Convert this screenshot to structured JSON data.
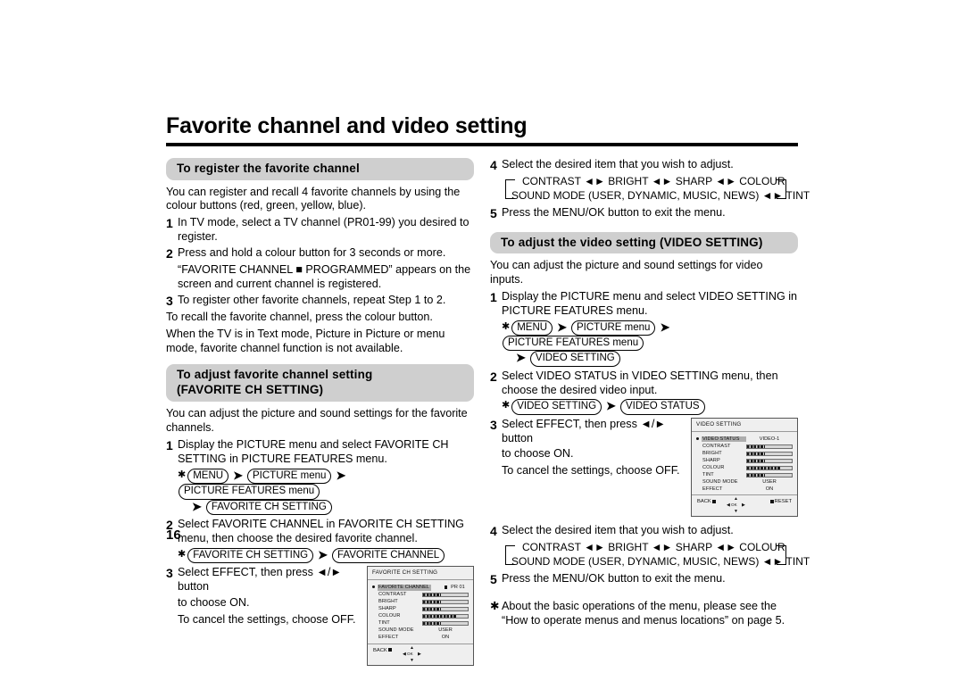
{
  "document": {
    "title": "Favorite channel and video setting",
    "page_number": "16"
  },
  "left_column": {
    "section1": {
      "heading": "To register the favorite channel",
      "intro": "You can register and recall 4 favorite channels by using the colour buttons (red, green, yellow, blue).",
      "steps": [
        {
          "num": "1",
          "text": "In TV mode, select a TV channel (PR01-99) you desired to register."
        },
        {
          "num": "2",
          "text": "Press and hold a colour button for 3 seconds or more."
        },
        {
          "num": "3",
          "text": "To register other favorite channels, repeat Step 1 to 2."
        }
      ],
      "step2_sub": "“FAVORITE CHANNEL ■ PROGRAMMED” appears on the screen and current channel is registered.",
      "outro1": "To recall the favorite channel, press the colour button.",
      "outro2": "When the TV is in Text mode, Picture in Picture or menu mode, favorite channel function is not available."
    },
    "section2": {
      "heading_line1": "To adjust favorite channel setting",
      "heading_line2": "(FAVORITE CH SETTING)",
      "intro": "You can adjust the picture and sound settings for the favorite channels.",
      "step1_num": "1",
      "step1_text": "Display the PICTURE menu and select FAVORITE CH SETTING in PICTURE FEATURES menu.",
      "crumbs1": [
        "MENU",
        "PICTURE menu",
        "PICTURE FEATURES menu",
        "FAVORITE CH SETTING"
      ],
      "step2_num": "2",
      "step2_text": "Select FAVORITE CHANNEL in FAVORITE CH SETTING menu, then choose the desired favorite channel.",
      "crumbs2": [
        "FAVORITE CH SETTING",
        "FAVORITE CHANNEL"
      ],
      "step3_num": "3",
      "step3_line1": "Select EFFECT, then press ◄/► button",
      "step3_line2": "to choose ON.",
      "step3_line3": "To cancel the settings, choose OFF."
    },
    "osd_favorite": {
      "title": "FAVORITE CH SETTING",
      "rows": [
        {
          "label": "FAVORITE CHANNEL",
          "type": "channel",
          "value": "PR 01",
          "selected": true
        },
        {
          "label": "CONTRAST",
          "type": "bar",
          "fill": 40
        },
        {
          "label": "BRIGHT",
          "type": "bar",
          "fill": 40
        },
        {
          "label": "SHARP",
          "type": "bar",
          "fill": 40
        },
        {
          "label": "COLOUR",
          "type": "bar",
          "fill": 75
        },
        {
          "label": "TINT",
          "type": "bar",
          "fill": 40
        },
        {
          "label": "SOUND MODE",
          "type": "text",
          "value": "USER"
        },
        {
          "label": "EFFECT",
          "type": "text",
          "value": "ON"
        }
      ],
      "back_label": "BACK",
      "ok_label": "OK",
      "reset_label": ""
    }
  },
  "right_column": {
    "section1_cont": {
      "step4_num": "4",
      "step4_text": "Select the desired item that you wish to adjust.",
      "cycle_row1": "CONTRAST ◄► BRIGHT ◄► SHARP ◄► COLOUR",
      "cycle_row2": "SOUND MODE (USER, DYNAMIC, MUSIC, NEWS) ◄► TINT",
      "step5_num": "5",
      "step5_text": "Press the MENU/OK button to exit the menu."
    },
    "section3": {
      "heading": "To adjust the video setting (VIDEO SETTING)",
      "intro": "You can adjust the picture and sound settings for video inputs.",
      "step1_num": "1",
      "step1_text": "Display the PICTURE menu and select VIDEO SETTING in PICTURE FEATURES menu.",
      "crumbs1": [
        "MENU",
        "PICTURE menu",
        "PICTURE FEATURES menu",
        "VIDEO SETTING"
      ],
      "step2_num": "2",
      "step2_text": "Select VIDEO STATUS in VIDEO SETTING menu, then choose the desired video input.",
      "crumbs2": [
        "VIDEO SETTING",
        "VIDEO STATUS"
      ],
      "step3_num": "3",
      "step3_line1": "Select EFFECT, then press ◄/► button",
      "step3_line2": "to choose ON.",
      "step3_line3": "To cancel the settings, choose OFF.",
      "step4_num": "4",
      "step4_text": "Select the desired item that you wish to adjust.",
      "cycle_row1": "CONTRAST ◄► BRIGHT ◄► SHARP ◄► COLOUR",
      "cycle_row2": "SOUND MODE (USER, DYNAMIC, MUSIC, NEWS) ◄► TINT",
      "step5_num": "5",
      "step5_text": "Press the MENU/OK button to exit the menu."
    },
    "osd_video": {
      "title": "VIDEO SETTING",
      "rows": [
        {
          "label": "VIDEO STATUS",
          "type": "text",
          "value": "VIDEO-1",
          "selected": true
        },
        {
          "label": "CONTRAST",
          "type": "bar",
          "fill": 40
        },
        {
          "label": "BRIGHT",
          "type": "bar",
          "fill": 40
        },
        {
          "label": "SHARP",
          "type": "bar",
          "fill": 40
        },
        {
          "label": "COLOUR",
          "type": "bar",
          "fill": 75
        },
        {
          "label": "TINT",
          "type": "bar",
          "fill": 40
        },
        {
          "label": "SOUND MODE",
          "type": "text",
          "value": "USER"
        },
        {
          "label": "EFFECT",
          "type": "text",
          "value": "ON"
        }
      ],
      "back_label": "BACK",
      "ok_label": "OK",
      "reset_label": "RESET"
    },
    "footnote": "About the basic operations of the menu, please see the “How to operate menus and menus locations” on page 5."
  }
}
